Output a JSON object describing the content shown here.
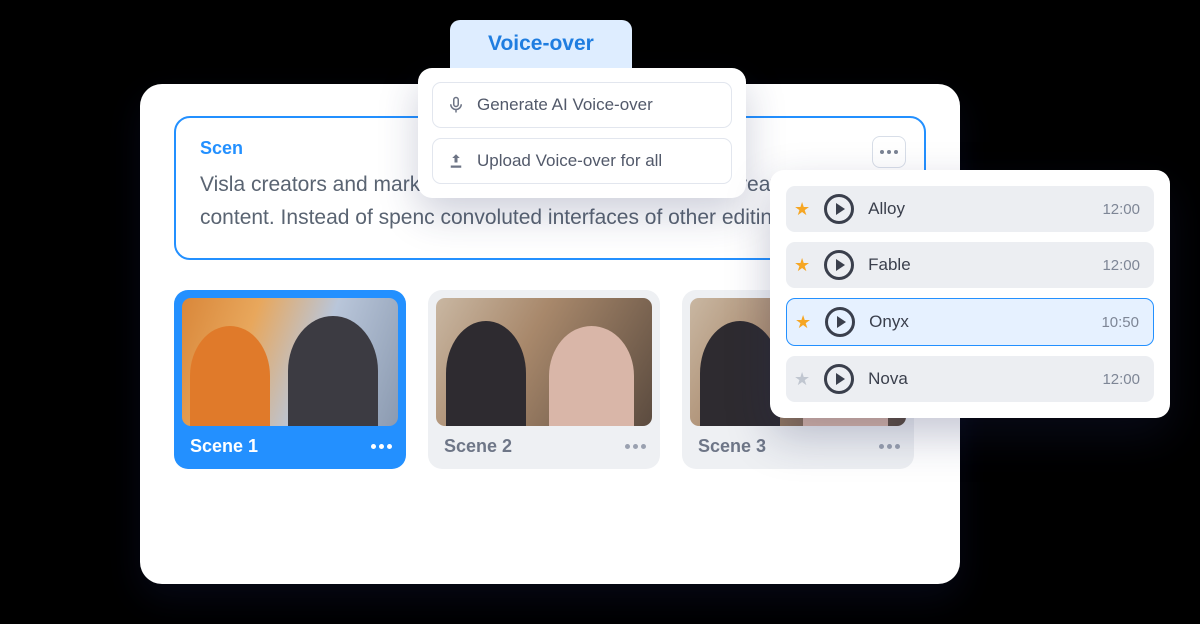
{
  "voiceover": {
    "tab_label": "Voice-over",
    "options": {
      "generate": "Generate AI Voice-over",
      "upload": "Upload Voice-over for all"
    }
  },
  "scene_text": {
    "title_prefix": "Scen",
    "body": "Visla                                                                  creators and marketers who want to leverage the p                           create video content. Instead of spenc                              convoluted interfaces of other editing"
  },
  "scenes": [
    {
      "label": "Scene 1",
      "active": true
    },
    {
      "label": "Scene 2",
      "active": false
    },
    {
      "label": "Scene 3",
      "active": false
    }
  ],
  "voices": [
    {
      "name": "Alloy",
      "time": "12:00",
      "starred": true,
      "selected": false
    },
    {
      "name": "Fable",
      "time": "12:00",
      "starred": true,
      "selected": false
    },
    {
      "name": "Onyx",
      "time": "10:50",
      "starred": true,
      "selected": true
    },
    {
      "name": "Nova",
      "time": "12:00",
      "starred": false,
      "selected": false
    }
  ]
}
